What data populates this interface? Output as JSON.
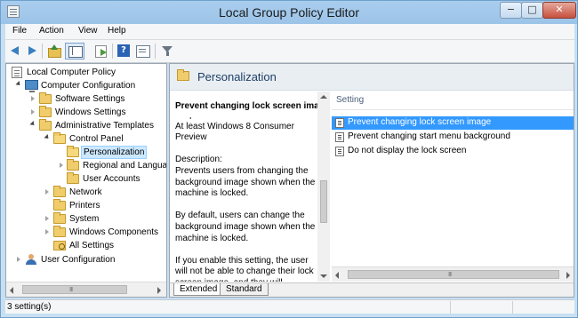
{
  "window": {
    "title": "Local Group Policy Editor",
    "minimize_glyph": "−",
    "maximize_glyph": "□",
    "close_glyph": "✕"
  },
  "menu": [
    "File",
    "Action",
    "View",
    "Help"
  ],
  "toolbar": {
    "icons": [
      "back-icon",
      "forward-icon",
      "up-folder-icon",
      "show-hide-tree-icon",
      "export-list-icon",
      "help-icon",
      "properties-icon",
      "filter-icon"
    ]
  },
  "tree": {
    "items": [
      {
        "label": "Local Computer Policy",
        "icon": "policy-icon",
        "expanded": true
      },
      {
        "label": "Computer Configuration",
        "icon": "computer-icon",
        "expanded": true
      },
      {
        "label": "Software Settings",
        "icon": "folder-icon",
        "expanded": false
      },
      {
        "label": "Windows Settings",
        "icon": "folder-icon",
        "expanded": false
      },
      {
        "label": "Administrative Templates",
        "icon": "folder-icon",
        "expanded": true
      },
      {
        "label": "Control Panel",
        "icon": "folder-icon",
        "expanded": true
      },
      {
        "label": "Personalization",
        "icon": "folder-open-icon",
        "selected": true
      },
      {
        "label": "Regional and Language",
        "icon": "folder-icon",
        "expanded": false
      },
      {
        "label": "User Accounts",
        "icon": "folder-icon"
      },
      {
        "label": "Network",
        "icon": "folder-icon",
        "expanded": false
      },
      {
        "label": "Printers",
        "icon": "folder-icon"
      },
      {
        "label": "System",
        "icon": "folder-icon",
        "expanded": false
      },
      {
        "label": "Windows Components",
        "icon": "folder-icon",
        "expanded": false
      },
      {
        "label": "All Settings",
        "icon": "all-settings-icon"
      },
      {
        "label": "User Configuration",
        "icon": "users-icon",
        "expanded": false
      }
    ],
    "scroll_grip": "III"
  },
  "content": {
    "header_title": "Personalization",
    "description": {
      "heading": "Prevent changing lock screen image",
      "body": "Requirements:\nAt least Windows 8 Consumer Preview\n\nDescription:\nPrevents users from changing the background image shown when the machine is locked.\n\nBy default, users can change the background image shown when the machine is locked.\n\nIf you enable this setting, the user will not be able to change their lock screen image, and they will"
    },
    "list": {
      "column_header": "Setting",
      "rows": [
        {
          "label": "Prevent changing lock screen image",
          "selected": true
        },
        {
          "label": "Prevent changing start menu background",
          "selected": false
        },
        {
          "label": "Do not display the lock screen",
          "selected": false
        }
      ],
      "scroll_grip": "III"
    },
    "tabs": [
      "Extended",
      "Standard"
    ]
  },
  "status": {
    "text": "3 setting(s)"
  }
}
